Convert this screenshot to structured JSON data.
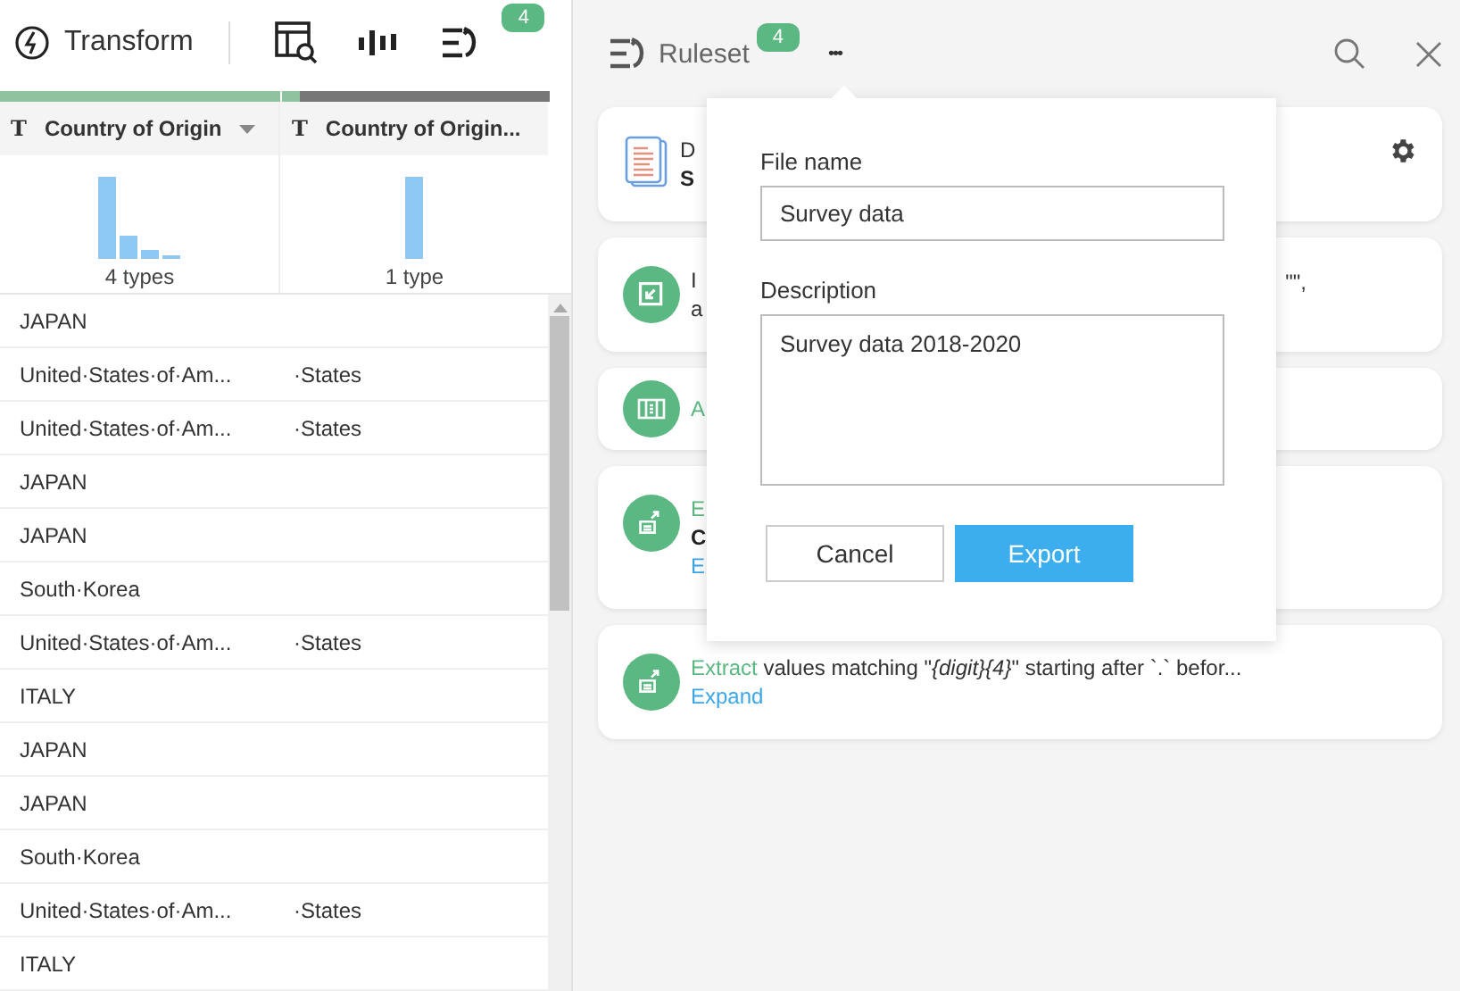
{
  "toolbar": {
    "title": "Transform",
    "badge": "4"
  },
  "columns": [
    {
      "type_glyph": "T",
      "name": "Country of Origin",
      "summary": "4 types",
      "sort_menu": true
    },
    {
      "type_glyph": "T",
      "name": "Country of Origin...",
      "summary": "1 type",
      "sort_menu": false
    }
  ],
  "rows": [
    [
      "JAPAN",
      ""
    ],
    [
      "United·States·of·Am...",
      "·States"
    ],
    [
      "United·States·of·Am...",
      "·States"
    ],
    [
      "JAPAN",
      ""
    ],
    [
      "JAPAN",
      ""
    ],
    [
      "South·Korea",
      ""
    ],
    [
      "United·States·of·Am...",
      "·States"
    ],
    [
      "ITALY",
      ""
    ],
    [
      "JAPAN",
      ""
    ],
    [
      "JAPAN",
      ""
    ],
    [
      "South·Korea",
      ""
    ],
    [
      "United·States·of·Am...",
      "·States"
    ],
    [
      "ITALY",
      ""
    ]
  ],
  "ruleset": {
    "title": "Ruleset",
    "badge": "4",
    "more": "•••"
  },
  "steps": [
    {
      "kind": "source",
      "line1": "D",
      "line2": "S"
    },
    {
      "kind": "import",
      "line1": "I",
      "line2": "a",
      "tail": "\"\","
    },
    {
      "kind": "columns",
      "line1": "A"
    },
    {
      "kind": "extract",
      "line1": "E",
      "line2": "C",
      "link": "E"
    },
    {
      "kind": "extract",
      "action": "Extract",
      "rest": "values matching \"*{digit}{4}*\" starting after `.` befor...",
      "link": "Expand"
    }
  ],
  "dialog": {
    "file_label": "File name",
    "file_value": "Survey data",
    "desc_label": "Description",
    "desc_value": "Survey data 2018-2020",
    "buttons": [
      "Cancel",
      "Export"
    ]
  }
}
